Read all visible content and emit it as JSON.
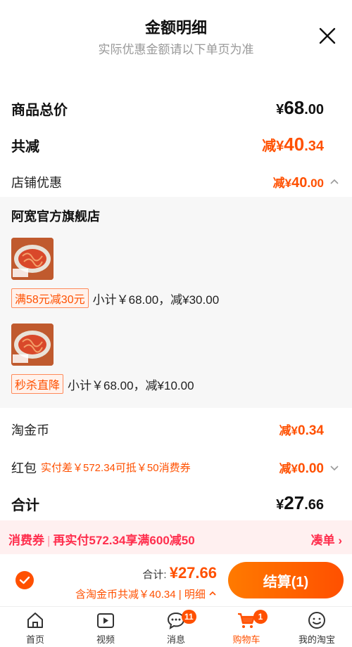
{
  "header": {
    "title": "金额明细",
    "subtitle": "实际优惠金额请以下单页为准"
  },
  "summary": {
    "goods_total_label": "商品总价",
    "goods_total_currency": "¥",
    "goods_total_int": "68",
    "goods_total_dec": ".00",
    "total_reduce_label": "共减",
    "total_reduce_prefix": "减¥",
    "total_reduce_int": "40",
    "total_reduce_dec": ".34",
    "shop_discount_label": "店铺优惠",
    "shop_discount_prefix": "减¥",
    "shop_discount_int": "40",
    "shop_discount_dec": ".00"
  },
  "shop": {
    "name": "阿宽官方旗舰店",
    "items": [
      {
        "tag": "满58元减30元",
        "detail": "小计￥68.00，减¥30.00"
      },
      {
        "tag": "秒杀直降",
        "detail": "小计￥68.00，减¥10.00"
      }
    ]
  },
  "taojinbi": {
    "label": "淘金币",
    "prefix": "减¥",
    "value": "0.34"
  },
  "hongbao": {
    "label": "红包",
    "note": "实付差￥572.34可抵￥50消费券",
    "prefix": "减¥",
    "value": "0.00"
  },
  "total": {
    "label": "合计",
    "currency": "¥",
    "int": "27",
    "dec": ".66"
  },
  "coupon_bar": {
    "tag": "消费券",
    "sep": "|",
    "text": "再实付572.34享满600减50",
    "action": "凑单 ›"
  },
  "checkout": {
    "total_label": "合计:",
    "total_amount": "¥27.66",
    "sub_text": "含淘金币共减￥40.34",
    "sub_sep": " | ",
    "detail_link": "明细",
    "pay_button": "结算(1)"
  },
  "tabbar": {
    "tabs": [
      {
        "label": "首页",
        "icon": "home-icon"
      },
      {
        "label": "视频",
        "icon": "video-icon"
      },
      {
        "label": "消息",
        "icon": "message-icon",
        "badge": "11"
      },
      {
        "label": "购物车",
        "icon": "cart-icon",
        "badge": "1"
      },
      {
        "label": "我的淘宝",
        "icon": "profile-icon"
      }
    ]
  },
  "colors": {
    "accent": "#ff5000",
    "coupon_red": "#ff2e4d",
    "coupon_bg": "#fff0f0",
    "panel_bg": "#f7f7f7"
  }
}
